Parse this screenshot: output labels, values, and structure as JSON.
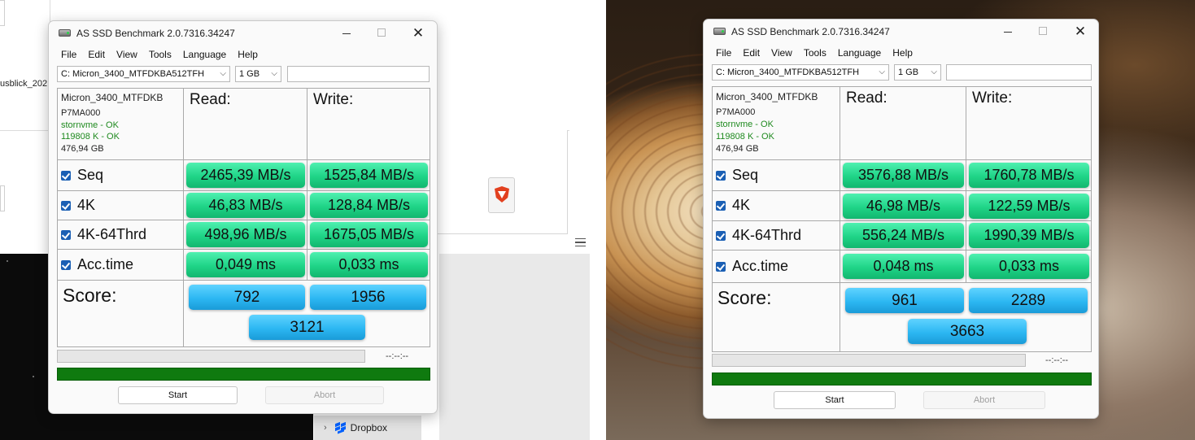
{
  "left_background": {
    "partial_text": "usblick_202",
    "dropbox_label": "Dropbox"
  },
  "windows": [
    {
      "title": "AS SSD Benchmark 2.0.7316.34247",
      "menu": [
        "File",
        "Edit",
        "View",
        "Tools",
        "Language",
        "Help"
      ],
      "drive_select": "C: Micron_3400_MTFDKBA512TFH",
      "size_select": "1 GB",
      "info": {
        "model": "Micron_3400_MTFDKB",
        "firmware": "P7MA000",
        "driver": "stornvme - OK",
        "alignment": "119808 K - OK",
        "capacity": "476,94 GB"
      },
      "read_label": "Read:",
      "write_label": "Write:",
      "rows": [
        {
          "label": "Seq",
          "read": "2465,39 MB/s",
          "write": "1525,84 MB/s"
        },
        {
          "label": "4K",
          "read": "46,83 MB/s",
          "write": "128,84 MB/s"
        },
        {
          "label": "4K-64Thrd",
          "read": "498,96 MB/s",
          "write": "1675,05 MB/s"
        },
        {
          "label": "Acc.time",
          "read": "0,049 ms",
          "write": "0,033 ms"
        }
      ],
      "score_label": "Score:",
      "score_read": "792",
      "score_write": "1956",
      "score_total": "3121",
      "time_text": "--:--:--",
      "start_label": "Start",
      "abort_label": "Abort"
    },
    {
      "title": "AS SSD Benchmark 2.0.7316.34247",
      "menu": [
        "File",
        "Edit",
        "View",
        "Tools",
        "Language",
        "Help"
      ],
      "drive_select": "C: Micron_3400_MTFDKBA512TFH",
      "size_select": "1 GB",
      "info": {
        "model": "Micron_3400_MTFDKB",
        "firmware": "P7MA000",
        "driver": "stornvme - OK",
        "alignment": "119808 K - OK",
        "capacity": "476,94 GB"
      },
      "read_label": "Read:",
      "write_label": "Write:",
      "rows": [
        {
          "label": "Seq",
          "read": "3576,88 MB/s",
          "write": "1760,78 MB/s"
        },
        {
          "label": "4K",
          "read": "46,98 MB/s",
          "write": "122,59 MB/s"
        },
        {
          "label": "4K-64Thrd",
          "read": "556,24 MB/s",
          "write": "1990,39 MB/s"
        },
        {
          "label": "Acc.time",
          "read": "0,048 ms",
          "write": "0,033 ms"
        }
      ],
      "score_label": "Score:",
      "score_read": "961",
      "score_write": "2289",
      "score_total": "3663",
      "time_text": "--:--:--",
      "start_label": "Start",
      "abort_label": "Abort"
    }
  ],
  "icons": {
    "app": "ssd-disk-icon",
    "minimize": "minimize-icon",
    "maximize": "maximize-icon",
    "close": "close-icon",
    "checkbox": "checkbox-checked-icon",
    "dropdown": "chevron-down-icon",
    "file": "brave-file-icon",
    "dropbox": "dropbox-icon"
  },
  "colors": {
    "value_box": "#1fd487",
    "score_box": "#2cb7f2",
    "progress_done": "#0f7a0f",
    "ok_text": "#1f8a1f",
    "checkbox": "#1a5fb4"
  }
}
